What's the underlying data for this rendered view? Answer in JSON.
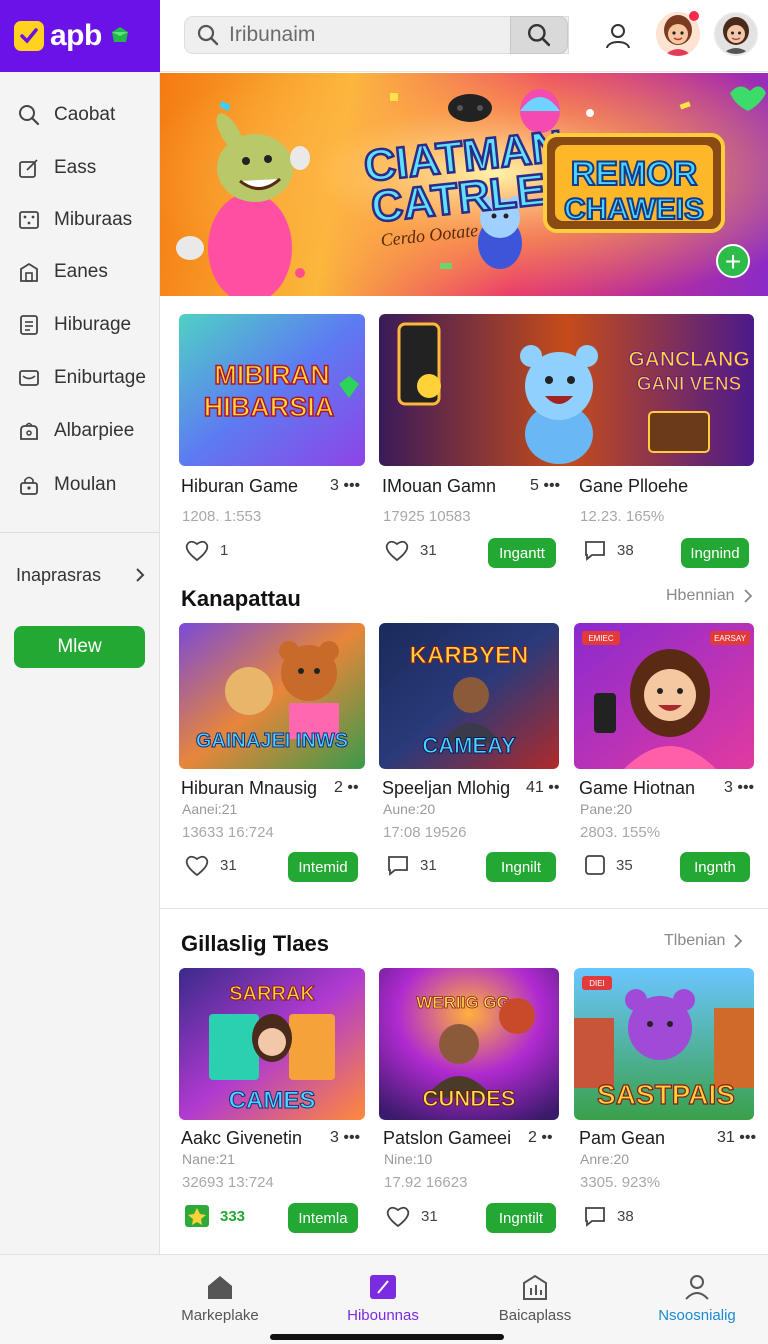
{
  "app": {
    "logo_text": "apb"
  },
  "header": {
    "search_placeholder": "Iribunaim"
  },
  "sidebar": {
    "items": [
      {
        "label": "Caobat",
        "icon": "search-icon"
      },
      {
        "label": "Eass",
        "icon": "edit-icon"
      },
      {
        "label": "Miburaas",
        "icon": "dice-icon"
      },
      {
        "label": "Eanes",
        "icon": "building-icon"
      },
      {
        "label": "Hiburage",
        "icon": "document-icon"
      },
      {
        "label": "Eniburtage",
        "icon": "mail-icon"
      },
      {
        "label": "Albarpiee",
        "icon": "bag-icon"
      },
      {
        "label": "Moulan",
        "icon": "lock-icon"
      }
    ],
    "more_label": "Inaprasras",
    "new_button": "Mlew"
  },
  "hero": {
    "title_line1": "CIATMAN",
    "title_line2": "CATRLE",
    "tagline": "Cerdo Ootate",
    "sign_line1": "REMOR",
    "sign_line2": "CHAWEIS"
  },
  "featured": [
    {
      "art_line1": "MIBIRAN",
      "art_line2": "HIBARSIA",
      "title": "Hiburan Game",
      "more": "3 •••",
      "stats": "1208. 1:553",
      "likes": "1"
    },
    {
      "art_line1": "GANCLANG",
      "art_line2": "GANI VENS",
      "title": "IMouan Gamn",
      "more": "5 •••",
      "stats": "17925 10583",
      "likes": "31",
      "button": "Ingantt"
    },
    {
      "title": "Gane Plloehe",
      "stats": "12.23. 165%",
      "comments": "38",
      "button": "Ingnind"
    }
  ],
  "section1": {
    "title": "Kanapattau",
    "link": "Hbennian",
    "cards": [
      {
        "art": "GAINAJEI INWS",
        "title": "Hiburan Mnausig",
        "more": "2 ••",
        "sub": "Aanei:21",
        "stats": "13633 16:724",
        "likes": "31",
        "button": "Intemid"
      },
      {
        "art_top": "KARBYEN",
        "art": "CAMEAY",
        "title": "Speeljan Mlohig",
        "more": "41 ••",
        "sub": "Aune:20",
        "stats": "17:08 19526",
        "comments": "31",
        "button": "Ingnilt"
      },
      {
        "badge1": "EMIEC",
        "badge2": "EARSAY",
        "title": "Game Hiotnan",
        "more": "3 •••",
        "sub": "Pane:20",
        "stats": "2803. 155%",
        "count": "35",
        "button": "Ingnth"
      }
    ]
  },
  "section2": {
    "title": "Gillaslig Tlaes",
    "link": "Tlbenian",
    "cards": [
      {
        "art_top": "SARRAK",
        "art": "CAMES",
        "title": "Aakc Givenetin",
        "more": "3 •••",
        "sub": "Nane:21",
        "stats": "32693 13:724",
        "score": "333",
        "button": "Intemla"
      },
      {
        "art_top": "WERIIG GG",
        "art": "CUNDES",
        "title": "Patslon Gameei",
        "more": "2 ••",
        "sub": "Nine:10",
        "stats": "17.92 16623",
        "likes": "31",
        "button": "Ingntilt"
      },
      {
        "badge1": "DIEI",
        "art": "SASTPAIS",
        "title": "Pam Gean",
        "more": "31 •••",
        "sub": "Anre:20",
        "stats": "3305. 923%",
        "comments": "38"
      }
    ]
  },
  "bottom_nav": [
    {
      "label": "Markeplake",
      "icon": "home-icon"
    },
    {
      "label": "Hibounnas",
      "icon": "game-icon"
    },
    {
      "label": "Baicaplass",
      "icon": "store-icon"
    },
    {
      "label": "Nsoosnialig",
      "icon": "profile-icon"
    }
  ],
  "colors": {
    "brand": "#6a12e8",
    "accent_green": "#23a933",
    "active_tab": "#7b2be0",
    "blue_tab": "#1a8bd1"
  }
}
